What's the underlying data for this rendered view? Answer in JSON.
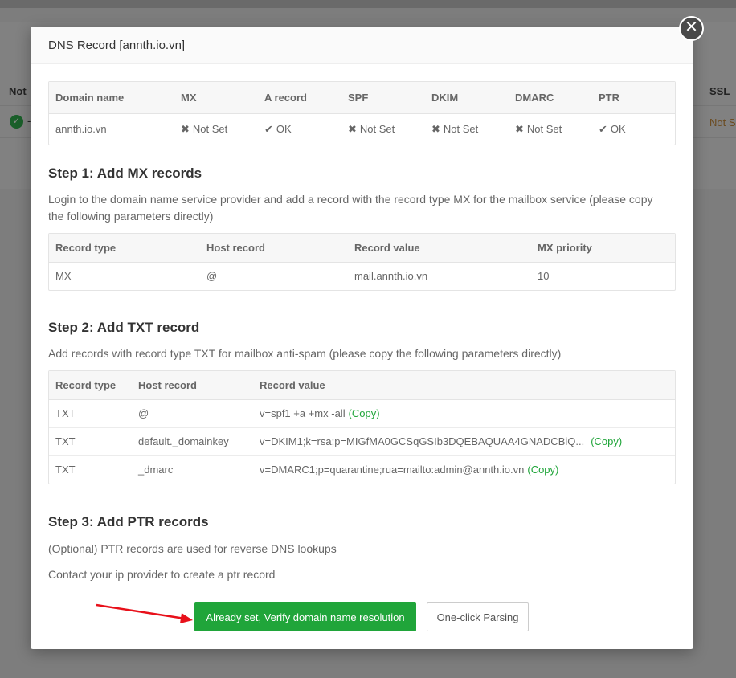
{
  "background": {
    "col_not": "Not",
    "col_ssl": "SSL",
    "row_dash": "-",
    "row_ssl": "Not S"
  },
  "modal": {
    "title": "DNS Record [annth.io.vn]",
    "close_icon": "close-icon"
  },
  "status_table": {
    "headers": [
      "Domain name",
      "MX",
      "A record",
      "SPF",
      "DKIM",
      "DMARC",
      "PTR"
    ],
    "domain": "annth.io.vn",
    "cells": [
      {
        "symbol": "✖",
        "text": "Not Set",
        "status": "bad"
      },
      {
        "symbol": "✔",
        "text": "OK",
        "status": "ok"
      },
      {
        "symbol": "✖",
        "text": "Not Set",
        "status": "bad"
      },
      {
        "symbol": "✖",
        "text": "Not Set",
        "status": "bad"
      },
      {
        "symbol": "✖",
        "text": "Not Set",
        "status": "bad"
      },
      {
        "symbol": "✔",
        "text": "OK",
        "status": "ok"
      }
    ]
  },
  "step1": {
    "title": "Step 1: Add MX records",
    "desc": "Login to the domain name service provider and add a record with the record type MX for the mailbox service (please copy the following parameters directly)",
    "headers": [
      "Record type",
      "Host record",
      "Record value",
      "MX priority"
    ],
    "row": [
      "MX",
      "@",
      "mail.annth.io.vn",
      "10"
    ]
  },
  "step2": {
    "title": "Step 2: Add TXT record",
    "desc": "Add records with record type TXT for mailbox anti-spam (please copy the following parameters directly)",
    "headers": [
      "Record type",
      "Host record",
      "Record value"
    ],
    "copy_label": "(Copy)",
    "rows": [
      {
        "type": "TXT",
        "host": "@",
        "value": "v=spf1 +a +mx -all"
      },
      {
        "type": "TXT",
        "host": "default._domainkey",
        "value": "v=DKIM1;k=rsa;p=MIGfMA0GCSqGSIb3DQEBAQUAA4GNADCBiQ..."
      },
      {
        "type": "TXT",
        "host": "_dmarc",
        "value": "v=DMARC1;p=quarantine;rua=mailto:admin@annth.io.vn"
      }
    ]
  },
  "step3": {
    "title": "Step 3: Add PTR records",
    "desc1": "(Optional) PTR records are used for reverse DNS lookups",
    "desc2": "Contact your ip provider to create a ptr record"
  },
  "buttons": {
    "verify": "Already set, Verify domain name resolution",
    "parse": "One-click Parsing"
  },
  "colors": {
    "accent": "#20a53a",
    "error": "#e8101a",
    "annotation_arrow": "#e8101a"
  }
}
